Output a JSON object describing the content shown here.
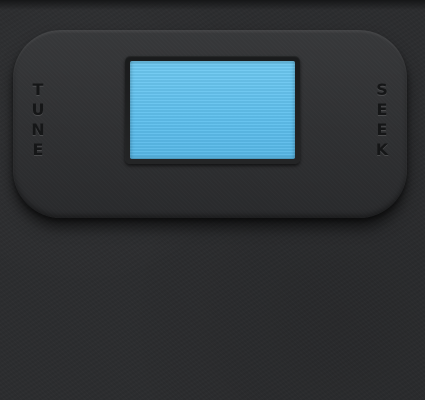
{
  "controls": {
    "tune_label": "TUNE",
    "seek_label": "SEEK"
  },
  "display": {
    "screen_color": "#62c3ef",
    "text": ""
  },
  "colors": {
    "background": "#2c2d2f",
    "panel": "#333436",
    "label": "#151617"
  }
}
